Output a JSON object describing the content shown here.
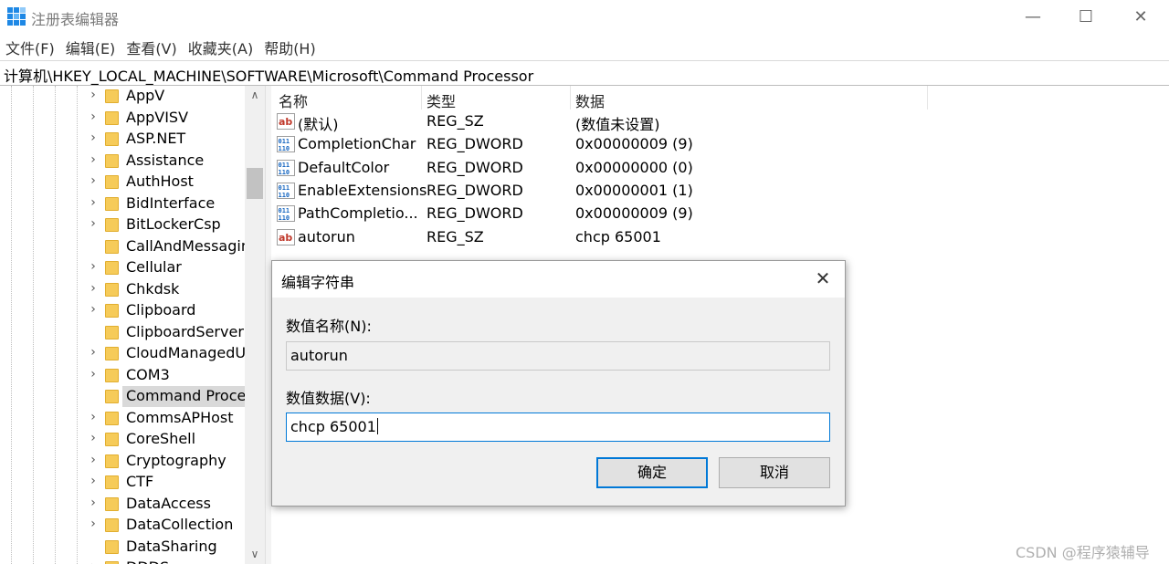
{
  "window": {
    "title": "注册表编辑器",
    "close": "✕",
    "minimize": "—",
    "maximize": "☐"
  },
  "menu": [
    "文件(F)",
    "编辑(E)",
    "查看(V)",
    "收藏夹(A)",
    "帮助(H)"
  ],
  "address": "计算机\\HKEY_LOCAL_MACHINE\\SOFTWARE\\Microsoft\\Command Processor",
  "tree": {
    "items": [
      {
        "label": "AppV",
        "expandable": true
      },
      {
        "label": "AppVISV",
        "expandable": true
      },
      {
        "label": "ASP.NET",
        "expandable": true
      },
      {
        "label": "Assistance",
        "expandable": true
      },
      {
        "label": "AuthHost",
        "expandable": true
      },
      {
        "label": "BidInterface",
        "expandable": true
      },
      {
        "label": "BitLockerCsp",
        "expandable": true
      },
      {
        "label": "CallAndMessagin",
        "expandable": false
      },
      {
        "label": "Cellular",
        "expandable": true
      },
      {
        "label": "Chkdsk",
        "expandable": true
      },
      {
        "label": "Clipboard",
        "expandable": true
      },
      {
        "label": "ClipboardServer",
        "expandable": false
      },
      {
        "label": "CloudManagedU",
        "expandable": true
      },
      {
        "label": "COM3",
        "expandable": true
      },
      {
        "label": "Command Proce",
        "expandable": false,
        "selected": true
      },
      {
        "label": "CommsAPHost",
        "expandable": true
      },
      {
        "label": "CoreShell",
        "expandable": true
      },
      {
        "label": "Cryptography",
        "expandable": true
      },
      {
        "label": "CTF",
        "expandable": true
      },
      {
        "label": "DataAccess",
        "expandable": true
      },
      {
        "label": "DataCollection",
        "expandable": true
      },
      {
        "label": "DataSharing",
        "expandable": false
      },
      {
        "label": "DDDS",
        "expandable": true
      }
    ]
  },
  "list": {
    "headers": {
      "name": "名称",
      "type": "类型",
      "data": "数据"
    },
    "rows": [
      {
        "icon": "string-value-icon",
        "name": "(默认)",
        "type": "REG_SZ",
        "data": "(数值未设置)"
      },
      {
        "icon": "binary-value-icon",
        "name": "CompletionChar",
        "type": "REG_DWORD",
        "data": "0x00000009 (9)"
      },
      {
        "icon": "binary-value-icon",
        "name": "DefaultColor",
        "type": "REG_DWORD",
        "data": "0x00000000 (0)"
      },
      {
        "icon": "binary-value-icon",
        "name": "EnableExtensions",
        "type": "REG_DWORD",
        "data": "0x00000001 (1)"
      },
      {
        "icon": "binary-value-icon",
        "name": "PathCompletio...",
        "type": "REG_DWORD",
        "data": "0x00000009 (9)"
      },
      {
        "icon": "string-value-icon",
        "name": "autorun",
        "type": "REG_SZ",
        "data": "chcp 65001"
      }
    ]
  },
  "dialog": {
    "title": "编辑字符串",
    "close": "✕",
    "name_label": "数值名称(N):",
    "name_value": "autorun",
    "data_label": "数值数据(V):",
    "data_value": "chcp 65001",
    "ok": "确定",
    "cancel": "取消"
  },
  "watermark": "CSDN @程序猿辅导",
  "colors": {
    "accent": "#0078d7",
    "folder": "#f6cb59",
    "selection": "#d9d9d9"
  }
}
